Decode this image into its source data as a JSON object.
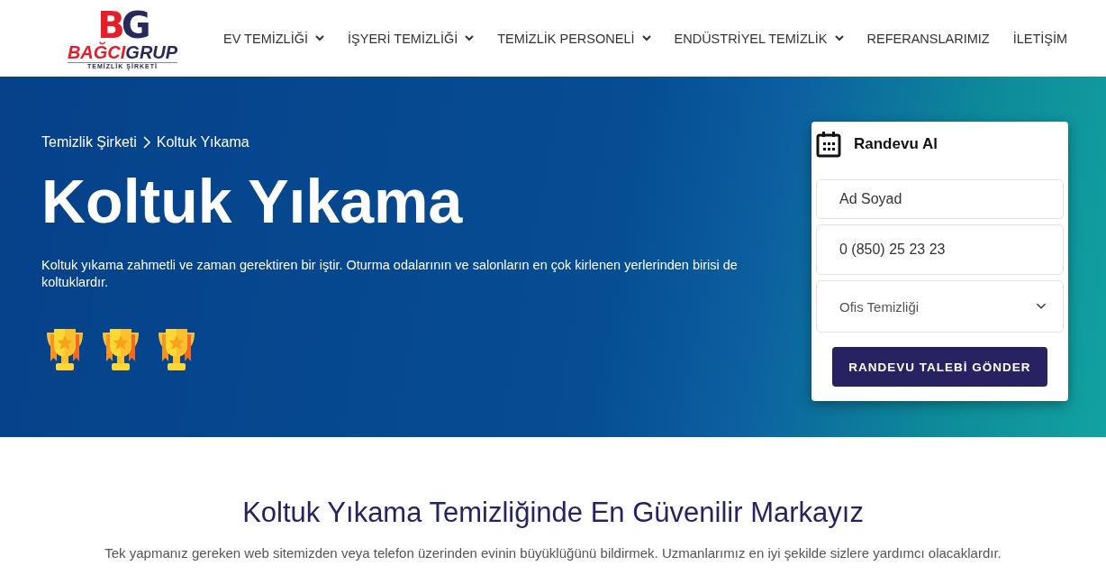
{
  "logo": {
    "monogram_left": "B",
    "monogram_right": "G",
    "name_left": "BAĞCI",
    "name_right": "GRUP",
    "tagline": "TEMİZLİK ŞİRKETİ"
  },
  "nav": [
    {
      "label": "EV TEMİZLİĞİ",
      "dropdown": true
    },
    {
      "label": "İŞYERİ TEMİZLİĞİ",
      "dropdown": true
    },
    {
      "label": "TEMİZLİK PERSONELİ",
      "dropdown": true
    },
    {
      "label": "ENDÜSTRİYEL TEMİZLİK",
      "dropdown": true
    },
    {
      "label": "REFERANSLARIMIZ",
      "dropdown": false
    },
    {
      "label": "İLETİŞİM",
      "dropdown": false
    }
  ],
  "hero": {
    "breadcrumb": [
      "Temizlik Şirketi",
      "Koltuk Yıkama"
    ],
    "title": "Koltuk Yıkama",
    "description": "Koltuk yıkama zahmetli ve zaman gerektiren bir iştir. Oturma odalarının ve salonların en çok kirlenen yerlerinden birisi de koltuklardır.",
    "badges": [
      {
        "kind": "trophy"
      },
      {
        "kind": "trophy"
      },
      {
        "kind": "trophy"
      }
    ]
  },
  "appointment": {
    "title": "Randevu Al",
    "name_field": {
      "placeholder": "Ad Soyad"
    },
    "phone_field": {
      "placeholder": "0 (850) 25 23 23"
    },
    "service_select": {
      "value": "Ofis Temizliği"
    },
    "submit": "RANDEVU TALEBİ GÖNDER"
  },
  "section": {
    "heading": "Koltuk Yıkama Temizliğinde En Güvenilir Markayız",
    "text": "Tek yapmanız gereken web sitemizden veya telefon üzerinden evinin büyüklüğünü bildirmek. Uzmanlarımız en iyi şekilde sizlere yardımcı olacaklardır."
  }
}
